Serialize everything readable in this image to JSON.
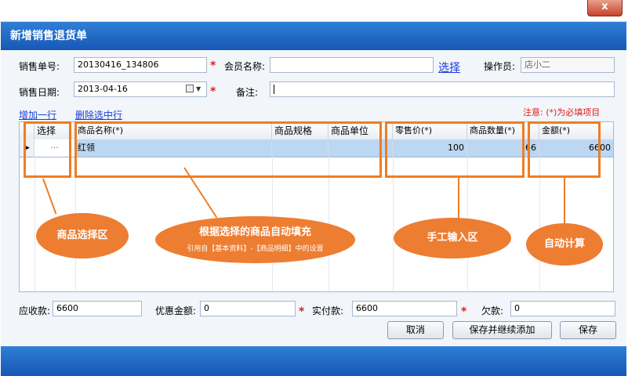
{
  "window": {
    "title": "新增销售退货单",
    "close_glyph": "x"
  },
  "form": {
    "sales_no_label": "销售单号:",
    "sales_no_value": "20130416_134806",
    "member_label": "会员名称:",
    "member_value": "",
    "select_link": "选择",
    "operator_label": "操作员:",
    "operator_value": "店小二",
    "sales_date_label": "销售日期:",
    "sales_date_value": "2013-04-16",
    "remark_label": "备注:",
    "remark_value": "",
    "required_mark": "*"
  },
  "actions": {
    "add_row": "增加一行",
    "delete_row": "删除选中行"
  },
  "notice": "注意: (*)为必填项目",
  "grid": {
    "columns": [
      "选择",
      "商品名称(*)",
      "商品规格",
      "商品单位",
      "零售价(*)",
      "商品数量(*)",
      "金额(*)"
    ],
    "rows": [
      {
        "select": "···",
        "name": "红领",
        "spec": "",
        "unit": "",
        "price": "100",
        "qty": "66",
        "amount": "6600"
      }
    ]
  },
  "annotations": {
    "select_area": "商品选择区",
    "auto_fill": "根据选择的商品自动填充",
    "auto_fill_sub": "引用自【基本资料】-【商品明细】中的设置",
    "manual_input": "手工输入区",
    "auto_calc": "自动计算"
  },
  "summary": {
    "receivable_label": "应收款:",
    "receivable_value": "6600",
    "discount_label": "优惠金额:",
    "discount_value": "0",
    "paid_label": "实付款:",
    "paid_value": "6600",
    "owed_label": "欠款:",
    "owed_value": "0"
  },
  "buttons": {
    "cancel": "取消",
    "save_continue": "保存并继续添加",
    "save": "保存"
  },
  "colors": {
    "header_blue": "#1f67c4",
    "highlight_orange": "#ed7d31",
    "row_selected": "#bcd7f2",
    "required_red": "#e0201a"
  },
  "icons": {
    "calendar": "calendar-icon",
    "dropdown": "chevron-down-icon",
    "row_pointer": "row-pointer-icon"
  }
}
